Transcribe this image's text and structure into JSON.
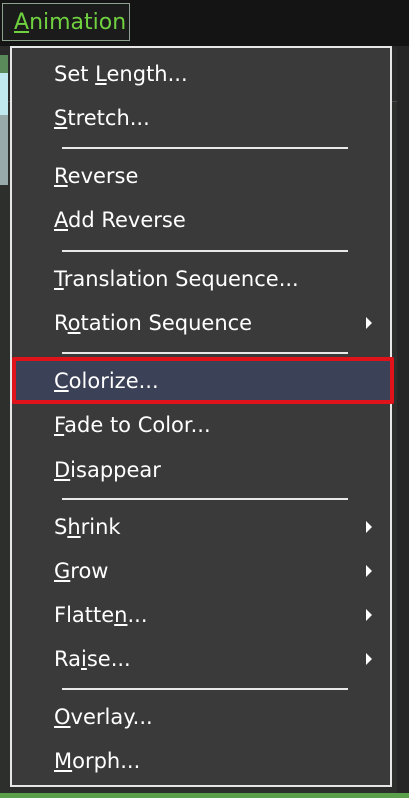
{
  "menubar": {
    "label_accel": "A",
    "label_rest": "nimation"
  },
  "menu": {
    "items": [
      {
        "pre": "Set ",
        "acc": "L",
        "post": "ength...",
        "submenu": false
      },
      {
        "pre": "",
        "acc": "S",
        "post": "tretch...",
        "submenu": false
      },
      {
        "pre": "",
        "acc": "R",
        "post": "everse",
        "submenu": false
      },
      {
        "pre": "",
        "acc": "A",
        "post": "dd Reverse",
        "submenu": false
      },
      {
        "pre": "",
        "acc": "T",
        "post": "ranslation Sequence...",
        "submenu": false
      },
      {
        "pre": "R",
        "acc": "o",
        "post": "tation Sequence",
        "submenu": true
      },
      {
        "pre": "",
        "acc": "C",
        "post": "olorize...",
        "submenu": false,
        "selected": true
      },
      {
        "pre": "",
        "acc": "F",
        "post": "ade to Color...",
        "submenu": false
      },
      {
        "pre": "",
        "acc": "D",
        "post": "isappear",
        "submenu": false
      },
      {
        "pre": "S",
        "acc": "h",
        "post": "rink",
        "submenu": true
      },
      {
        "pre": "",
        "acc": "G",
        "post": "row",
        "submenu": true
      },
      {
        "pre": "Flatte",
        "acc": "n",
        "post": "...",
        "submenu": true
      },
      {
        "pre": "Ra",
        "acc": "i",
        "post": "se...",
        "submenu": true
      },
      {
        "pre": "",
        "acc": "O",
        "post": "verlay...",
        "submenu": false
      },
      {
        "pre": "",
        "acc": "M",
        "post": "orph...",
        "submenu": false
      }
    ]
  },
  "colors": {
    "accent": "#6fd13f",
    "selection": "#3b4157",
    "highlight_border": "#e0121a"
  }
}
